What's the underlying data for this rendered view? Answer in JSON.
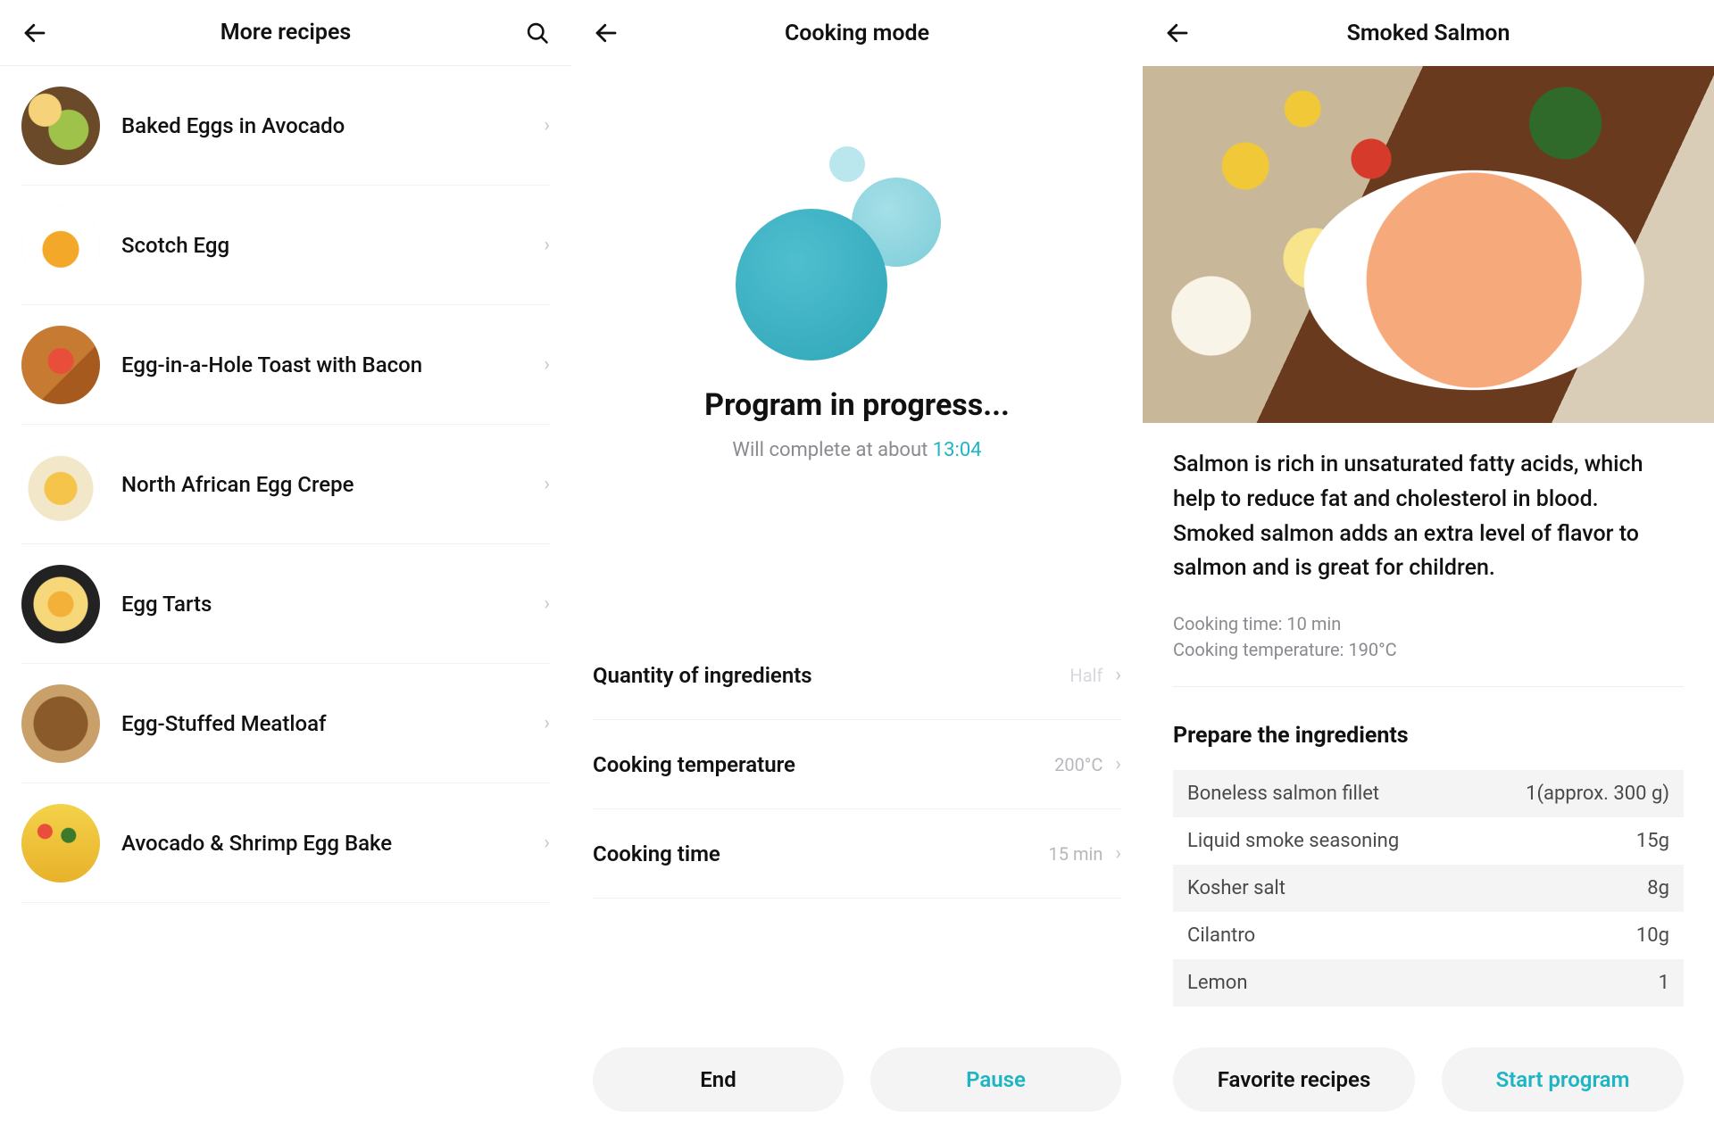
{
  "panel1": {
    "title": "More recipes",
    "items": [
      {
        "name": "Baked Eggs in Avocado"
      },
      {
        "name": "Scotch Egg"
      },
      {
        "name": "Egg-in-a-Hole Toast with Bacon"
      },
      {
        "name": "North African Egg Crepe"
      },
      {
        "name": "Egg Tarts"
      },
      {
        "name": "Egg-Stuffed Meatloaf"
      },
      {
        "name": "Avocado & Shrimp Egg Bake"
      }
    ]
  },
  "panel2": {
    "title": "Cooking mode",
    "progress_heading": "Program in progress...",
    "complete_prefix": "Will complete at about ",
    "complete_time": "13:04",
    "settings": [
      {
        "label": "Quantity of ingredients",
        "value": "Half"
      },
      {
        "label": "Cooking temperature",
        "value": "200°C"
      },
      {
        "label": "Cooking time",
        "value": "15 min"
      }
    ],
    "buttons": {
      "end": "End",
      "pause": "Pause"
    }
  },
  "panel3": {
    "title": "Smoked Salmon",
    "description": "Salmon is rich in unsaturated fatty acids, which help to reduce fat and cholesterol in blood. Smoked salmon adds an extra level of flavor to salmon and is great for children.",
    "meta": {
      "cooking_time_label": "Cooking time: ",
      "cooking_time_value": "10 min",
      "cooking_temp_label": "Cooking temperature: ",
      "cooking_temp_value": "190°C"
    },
    "section_title": "Prepare the ingredients",
    "ingredients": [
      {
        "name": "Boneless salmon fillet",
        "amount": "1(approx. 300 g)"
      },
      {
        "name": "Liquid smoke seasoning",
        "amount": "15g"
      },
      {
        "name": "Kosher salt",
        "amount": "8g"
      },
      {
        "name": "Cilantro",
        "amount": "10g"
      },
      {
        "name": "Lemon",
        "amount": "1"
      }
    ],
    "buttons": {
      "favorite": "Favorite recipes",
      "start": "Start program"
    }
  }
}
